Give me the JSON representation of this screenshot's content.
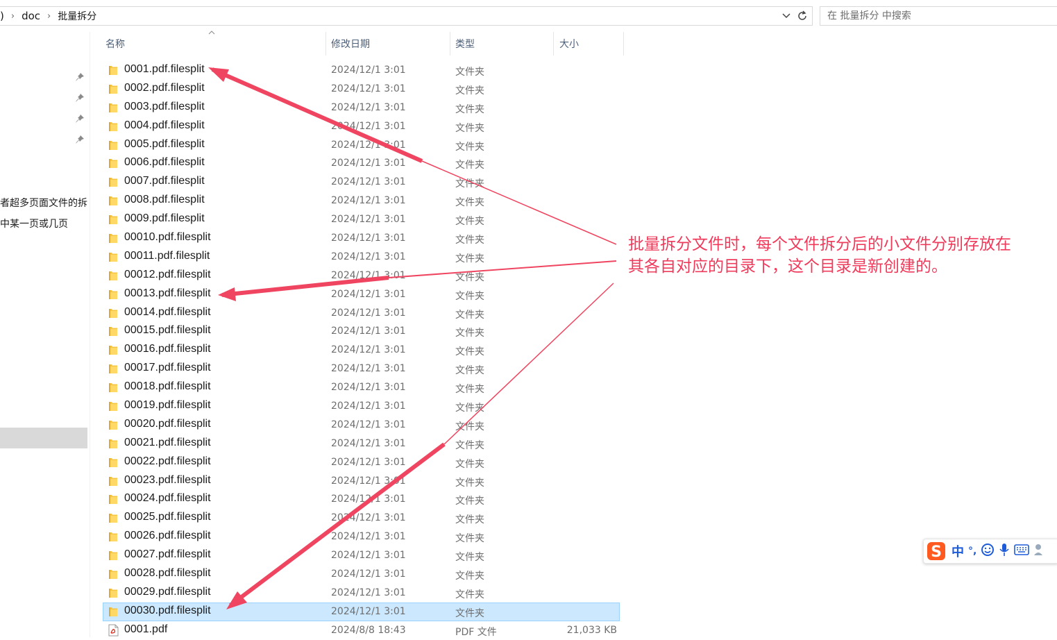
{
  "address": {
    "crumbs": [
      ")",
      "doc",
      "批量拆分"
    ]
  },
  "search": {
    "placeholder": "在 批量拆分 中搜索"
  },
  "nav": {
    "text1": "者超多页面文件的拆",
    "text2": "中某一页或几页"
  },
  "columns": {
    "name": "名称",
    "date": "修改日期",
    "type": "类型",
    "size": "大小"
  },
  "rows": [
    {
      "name": "0001.pdf.filesplit",
      "date": "2024/12/1 3:01",
      "type": "文件夹",
      "size": ""
    },
    {
      "name": "0002.pdf.filesplit",
      "date": "2024/12/1 3:01",
      "type": "文件夹",
      "size": ""
    },
    {
      "name": "0003.pdf.filesplit",
      "date": "2024/12/1 3:01",
      "type": "文件夹",
      "size": ""
    },
    {
      "name": "0004.pdf.filesplit",
      "date": "2024/12/1 3:01",
      "type": "文件夹",
      "size": ""
    },
    {
      "name": "0005.pdf.filesplit",
      "date": "2024/12/1 3:01",
      "type": "文件夹",
      "size": ""
    },
    {
      "name": "0006.pdf.filesplit",
      "date": "2024/12/1 3:01",
      "type": "文件夹",
      "size": ""
    },
    {
      "name": "0007.pdf.filesplit",
      "date": "2024/12/1 3:01",
      "type": "文件夹",
      "size": ""
    },
    {
      "name": "0008.pdf.filesplit",
      "date": "2024/12/1 3:01",
      "type": "文件夹",
      "size": ""
    },
    {
      "name": "0009.pdf.filesplit",
      "date": "2024/12/1 3:01",
      "type": "文件夹",
      "size": ""
    },
    {
      "name": "00010.pdf.filesplit",
      "date": "2024/12/1 3:01",
      "type": "文件夹",
      "size": ""
    },
    {
      "name": "00011.pdf.filesplit",
      "date": "2024/12/1 3:01",
      "type": "文件夹",
      "size": ""
    },
    {
      "name": "00012.pdf.filesplit",
      "date": "2024/12/1 3:01",
      "type": "文件夹",
      "size": ""
    },
    {
      "name": "00013.pdf.filesplit",
      "date": "2024/12/1 3:01",
      "type": "文件夹",
      "size": ""
    },
    {
      "name": "00014.pdf.filesplit",
      "date": "2024/12/1 3:01",
      "type": "文件夹",
      "size": ""
    },
    {
      "name": "00015.pdf.filesplit",
      "date": "2024/12/1 3:01",
      "type": "文件夹",
      "size": ""
    },
    {
      "name": "00016.pdf.filesplit",
      "date": "2024/12/1 3:01",
      "type": "文件夹",
      "size": ""
    },
    {
      "name": "00017.pdf.filesplit",
      "date": "2024/12/1 3:01",
      "type": "文件夹",
      "size": ""
    },
    {
      "name": "00018.pdf.filesplit",
      "date": "2024/12/1 3:01",
      "type": "文件夹",
      "size": ""
    },
    {
      "name": "00019.pdf.filesplit",
      "date": "2024/12/1 3:01",
      "type": "文件夹",
      "size": ""
    },
    {
      "name": "00020.pdf.filesplit",
      "date": "2024/12/1 3:01",
      "type": "文件夹",
      "size": ""
    },
    {
      "name": "00021.pdf.filesplit",
      "date": "2024/12/1 3:01",
      "type": "文件夹",
      "size": ""
    },
    {
      "name": "00022.pdf.filesplit",
      "date": "2024/12/1 3:01",
      "type": "文件夹",
      "size": ""
    },
    {
      "name": "00023.pdf.filesplit",
      "date": "2024/12/1 3:01",
      "type": "文件夹",
      "size": ""
    },
    {
      "name": "00024.pdf.filesplit",
      "date": "2024/12/1 3:01",
      "type": "文件夹",
      "size": ""
    },
    {
      "name": "00025.pdf.filesplit",
      "date": "2024/12/1 3:01",
      "type": "文件夹",
      "size": ""
    },
    {
      "name": "00026.pdf.filesplit",
      "date": "2024/12/1 3:01",
      "type": "文件夹",
      "size": ""
    },
    {
      "name": "00027.pdf.filesplit",
      "date": "2024/12/1 3:01",
      "type": "文件夹",
      "size": ""
    },
    {
      "name": "00028.pdf.filesplit",
      "date": "2024/12/1 3:01",
      "type": "文件夹",
      "size": ""
    },
    {
      "name": "00029.pdf.filesplit",
      "date": "2024/12/1 3:01",
      "type": "文件夹",
      "size": ""
    },
    {
      "name": "00030.pdf.filesplit",
      "date": "2024/12/1 3:01",
      "type": "文件夹",
      "size": "",
      "selected": true
    },
    {
      "name": "0001.pdf",
      "date": "2024/8/8 18:43",
      "type": "PDF 文件",
      "size": "21,033 KB",
      "kind": "pdf"
    }
  ],
  "annotation": {
    "line1": "批量拆分文件时，每个文件拆分后的小文件分别存放在",
    "line2": "其各自对应的目录下，这个目录是新创建的。",
    "color": "#ef3b5b"
  },
  "ime": {
    "mode": "中",
    "punct": "°,",
    "logo": "S"
  },
  "icons": {
    "dropdown": "chevron-down-icon",
    "refresh": "refresh-icon",
    "pin": "pin-icon",
    "folder": "folder-icon",
    "pdf": "pdf-file-icon"
  }
}
